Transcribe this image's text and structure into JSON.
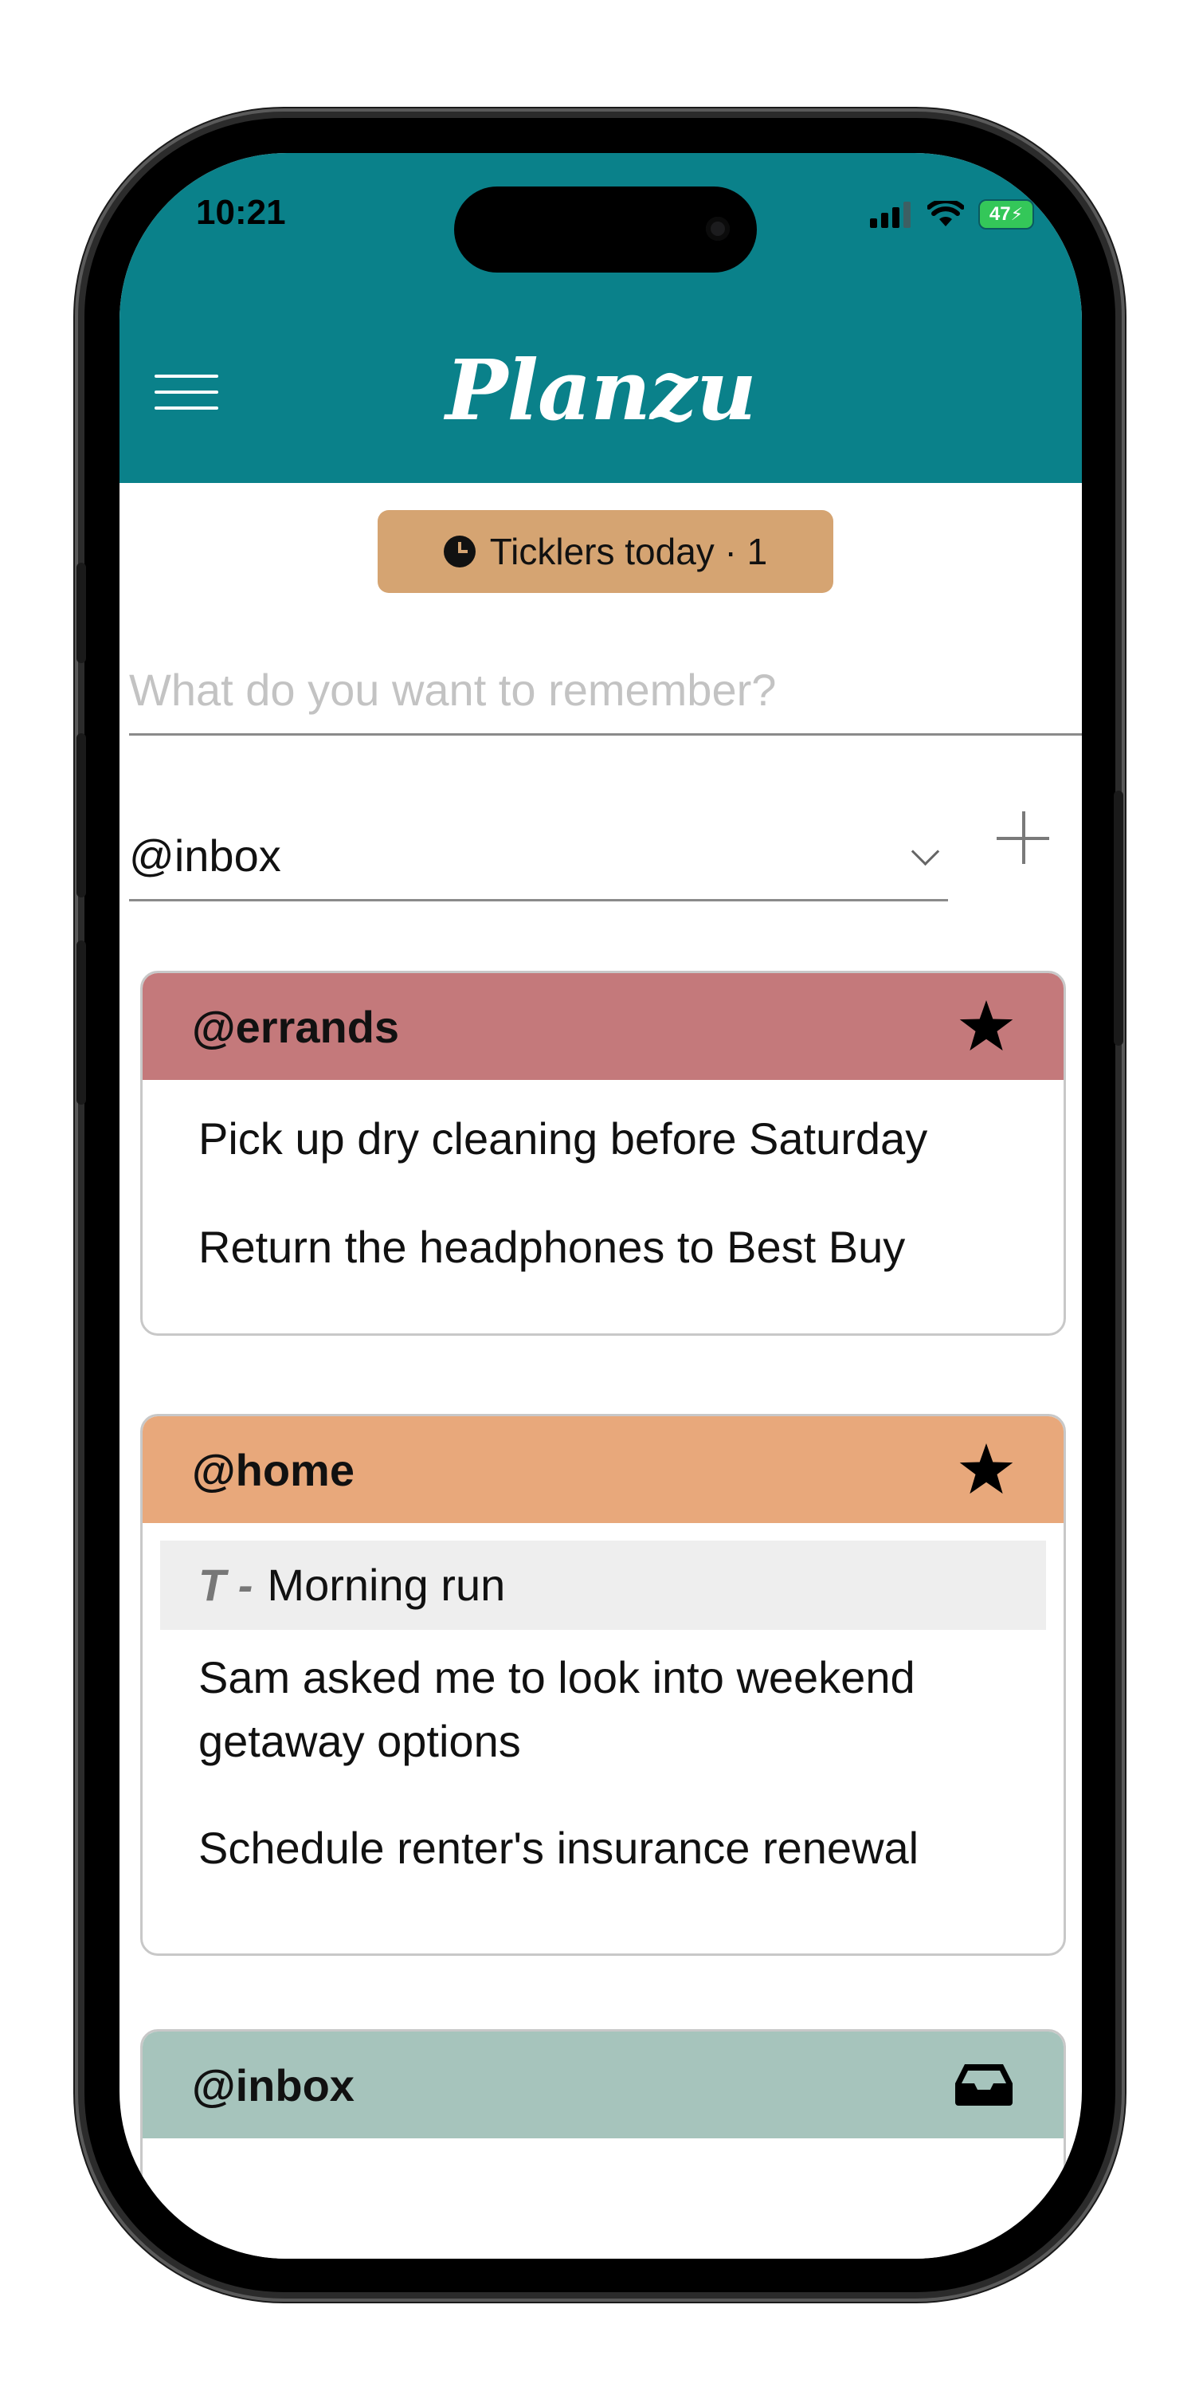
{
  "status_bar": {
    "time": "10:21",
    "battery": "47"
  },
  "header": {
    "brand": "Planzu"
  },
  "tickler_button": {
    "label": "Ticklers today · 1"
  },
  "new_item": {
    "placeholder": "What do you want to remember?",
    "value": ""
  },
  "context_select": {
    "selected": "@inbox"
  },
  "cards": [
    {
      "title": "@errands",
      "color": "#c4797b",
      "icon": "star-icon",
      "items": [
        {
          "text": "Pick up dry cleaning before Saturday"
        },
        {
          "text": "Return the headphones to Best Buy"
        }
      ]
    },
    {
      "title": "@home",
      "color": "#e8a87b",
      "icon": "star-icon",
      "items": [
        {
          "prefix": "T -",
          "text": "Morning run"
        },
        {
          "text": "Sam asked me to look into weekend getaway options"
        },
        {
          "text": "Schedule renter's insurance renewal"
        }
      ]
    },
    {
      "title": "@inbox",
      "color": "#a6c4bc",
      "icon": "inbox-tray-icon",
      "items": []
    }
  ],
  "colors": {
    "header": "#0a818a",
    "tickler": "#d5a472",
    "brand_text": "#ffffff"
  }
}
